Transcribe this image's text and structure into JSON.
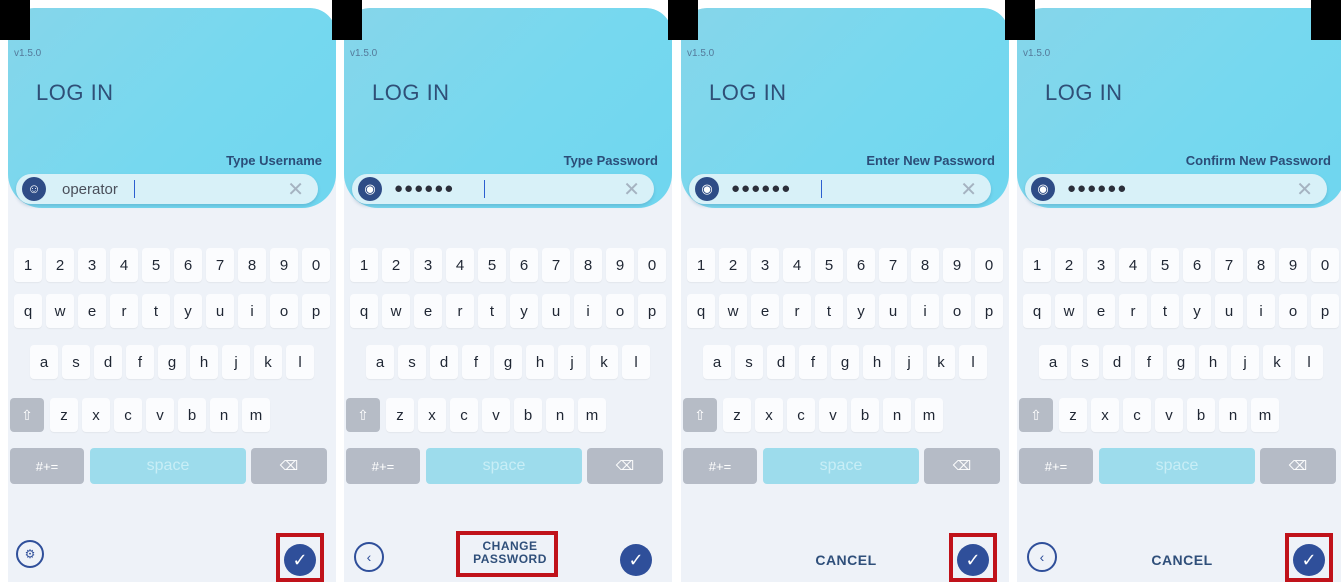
{
  "panels": [
    {
      "version": "v1.5.0",
      "title": "LOG IN",
      "field_label": "Type Username",
      "field_value": "operator",
      "field_icon": "user-icon",
      "masked": false,
      "footer": {
        "left": "user-settings-icon",
        "right": "confirm-check-icon",
        "highlight": "confirm"
      }
    },
    {
      "version": "v1.5.0",
      "title": "LOG IN",
      "field_label": "Type Password",
      "field_value": "●●●●●●",
      "field_icon": "eye-icon",
      "masked": true,
      "footer": {
        "left": "back-arrow-icon",
        "center": "CHANGE PASSWORD",
        "right": "confirm-check-icon",
        "highlight": "change-password"
      }
    },
    {
      "version": "v1.5.0",
      "title": "LOG IN",
      "field_label": "Enter New Password",
      "field_value": "●●●●●●",
      "field_icon": "eye-icon",
      "masked": true,
      "footer": {
        "center": "CANCEL",
        "right": "confirm-check-icon",
        "highlight": "confirm"
      }
    },
    {
      "version": "v1.5.0",
      "title": "LOG IN",
      "field_label": "Confirm New Password",
      "field_value": "●●●●●●",
      "field_icon": "eye-icon",
      "masked": true,
      "footer": {
        "left": "back-arrow-icon",
        "center": "CANCEL",
        "right": "confirm-check-icon",
        "highlight": "confirm"
      }
    }
  ],
  "keyboard": {
    "row1": [
      "1",
      "2",
      "3",
      "4",
      "5",
      "6",
      "7",
      "8",
      "9",
      "0"
    ],
    "row2": [
      "q",
      "w",
      "e",
      "r",
      "t",
      "y",
      "u",
      "i",
      "o",
      "p"
    ],
    "row3": [
      "a",
      "s",
      "d",
      "f",
      "g",
      "h",
      "j",
      "k",
      "l"
    ],
    "row4": [
      "z",
      "x",
      "c",
      "v",
      "b",
      "n",
      "m"
    ],
    "symbols_label": "#+=",
    "space_label": "space"
  },
  "colors": {
    "accent": "#2f4f9a",
    "highlight": "#c0121a",
    "header_gradient": "#76d8ef"
  }
}
